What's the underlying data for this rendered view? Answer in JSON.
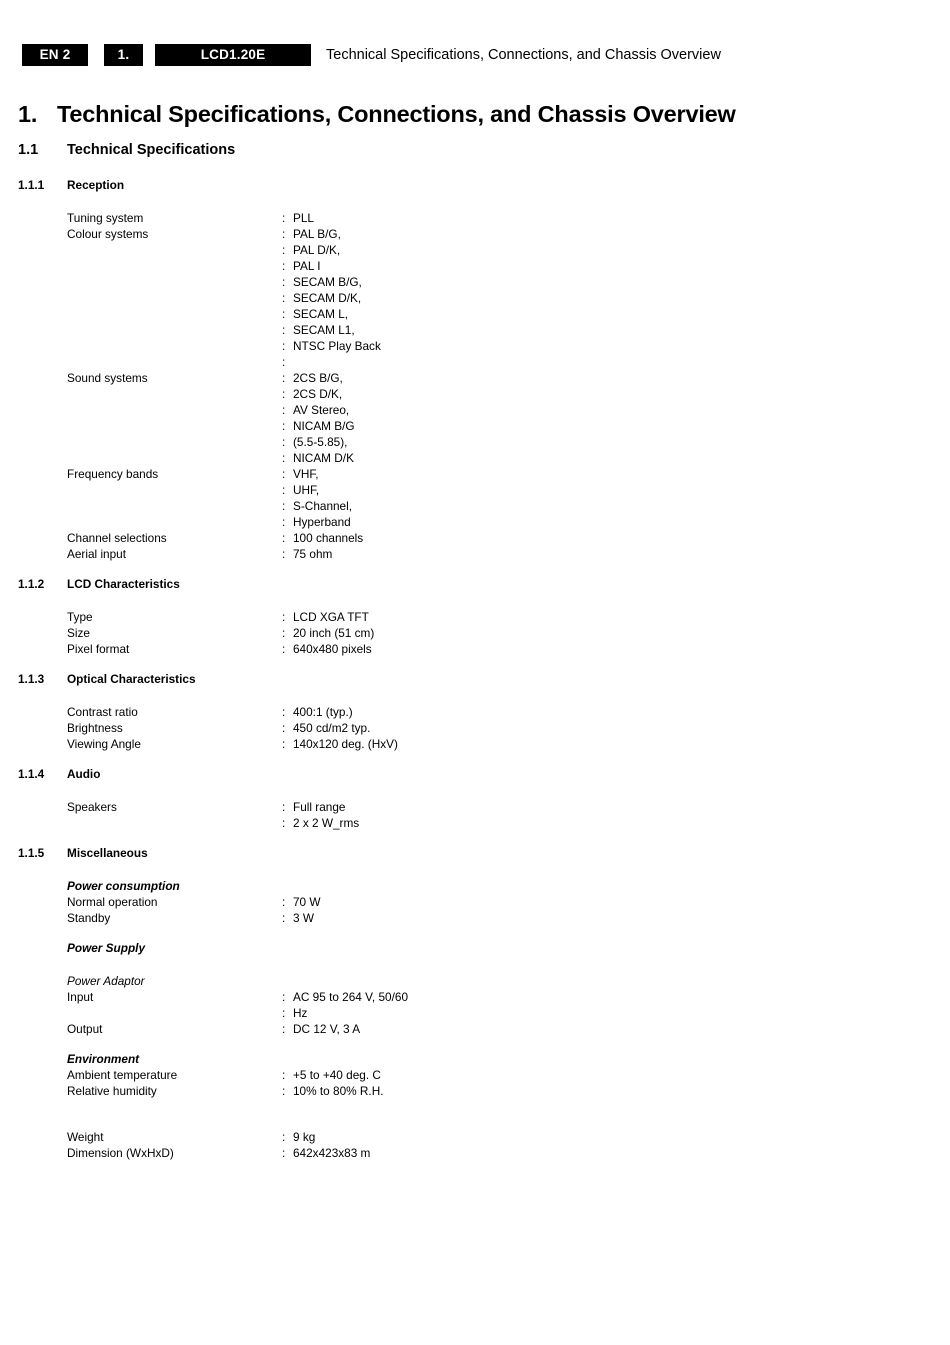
{
  "header": {
    "lang_box": "EN 2",
    "section_box": "1.",
    "chassis_box": "LCD1.20E",
    "title": "Technical Specifications, Connections, and Chassis Overview"
  },
  "chapter": {
    "number": "1.",
    "title": "Technical Specifications, Connections, and Chassis Overview"
  },
  "sections": {
    "s11": {
      "number": "1.1",
      "title": "Technical Specifications"
    },
    "s111": {
      "number": "1.1.1",
      "title": "Reception"
    },
    "s112": {
      "number": "1.1.2",
      "title": "LCD Characteristics"
    },
    "s113": {
      "number": "1.1.3",
      "title": "Optical Characteristics"
    },
    "s114": {
      "number": "1.1.4",
      "title": "Audio"
    },
    "s115": {
      "number": "1.1.5",
      "title": "Miscellaneous"
    }
  },
  "colon": ":",
  "reception": [
    {
      "label": "Tuning system",
      "value": "PLL"
    },
    {
      "label": "Colour systems",
      "value": "PAL B/G,"
    },
    {
      "label": "",
      "value": "PAL D/K,"
    },
    {
      "label": "",
      "value": "PAL I"
    },
    {
      "label": "",
      "value": "SECAM B/G,"
    },
    {
      "label": "",
      "value": "SECAM D/K,"
    },
    {
      "label": "",
      "value": "SECAM L,"
    },
    {
      "label": "",
      "value": "SECAM L1,"
    },
    {
      "label": "",
      "value": "NTSC Play Back"
    },
    {
      "label": "",
      "value": ""
    },
    {
      "label": "Sound systems",
      "value": "2CS B/G,"
    },
    {
      "label": "",
      "value": "2CS D/K,"
    },
    {
      "label": "",
      "value": "AV Stereo,"
    },
    {
      "label": "",
      "value": "NICAM B/G"
    },
    {
      "label": "",
      "value": "(5.5-5.85),"
    },
    {
      "label": "",
      "value": "NICAM D/K"
    },
    {
      "label": "Frequency bands",
      "value": "VHF,"
    },
    {
      "label": "",
      "value": "UHF,"
    },
    {
      "label": "",
      "value": "S-Channel,"
    },
    {
      "label": "",
      "value": "Hyperband"
    },
    {
      "label": "Channel selections",
      "value": "100 channels"
    },
    {
      "label": "Aerial input",
      "value": "75 ohm"
    }
  ],
  "lcd_characteristics": [
    {
      "label": "Type",
      "value": "LCD XGA TFT"
    },
    {
      "label": "Size",
      "value": "20 inch (51 cm)"
    },
    {
      "label": "Pixel format",
      "value": "640x480 pixels"
    }
  ],
  "optical_characteristics": [
    {
      "label": "Contrast ratio",
      "value": "400:1 (typ.)"
    },
    {
      "label": "Brightness",
      "value": "450 cd/m2 typ."
    },
    {
      "label": "Viewing Angle",
      "value": "140x120 deg. (HxV)"
    }
  ],
  "audio": [
    {
      "label": "Speakers",
      "value": "Full range"
    },
    {
      "label": "",
      "value": "2 x 2 W_rms"
    }
  ],
  "misc": {
    "power_consumption_heading": "Power consumption",
    "power_consumption": [
      {
        "label": "Normal operation",
        "value": "70 W"
      },
      {
        "label": "Standby",
        "value": "3 W"
      }
    ],
    "power_supply_heading": "Power Supply",
    "power_adaptor_heading": "Power Adaptor",
    "power_adaptor": [
      {
        "label": "Input",
        "value": "AC 95 to 264 V, 50/60"
      },
      {
        "label": "",
        "value": "Hz"
      },
      {
        "label": "Output",
        "value": "DC 12 V, 3 A"
      }
    ],
    "environment_heading": "Environment",
    "environment": [
      {
        "label": "Ambient temperature",
        "value": "+5 to +40 deg. C"
      },
      {
        "label": "Relative humidity",
        "value": "10% to 80% R.H."
      }
    ],
    "physical": [
      {
        "label": "Weight",
        "value": "9 kg"
      },
      {
        "label": "Dimension (WxHxD)",
        "value": "642x423x83 m"
      }
    ]
  }
}
